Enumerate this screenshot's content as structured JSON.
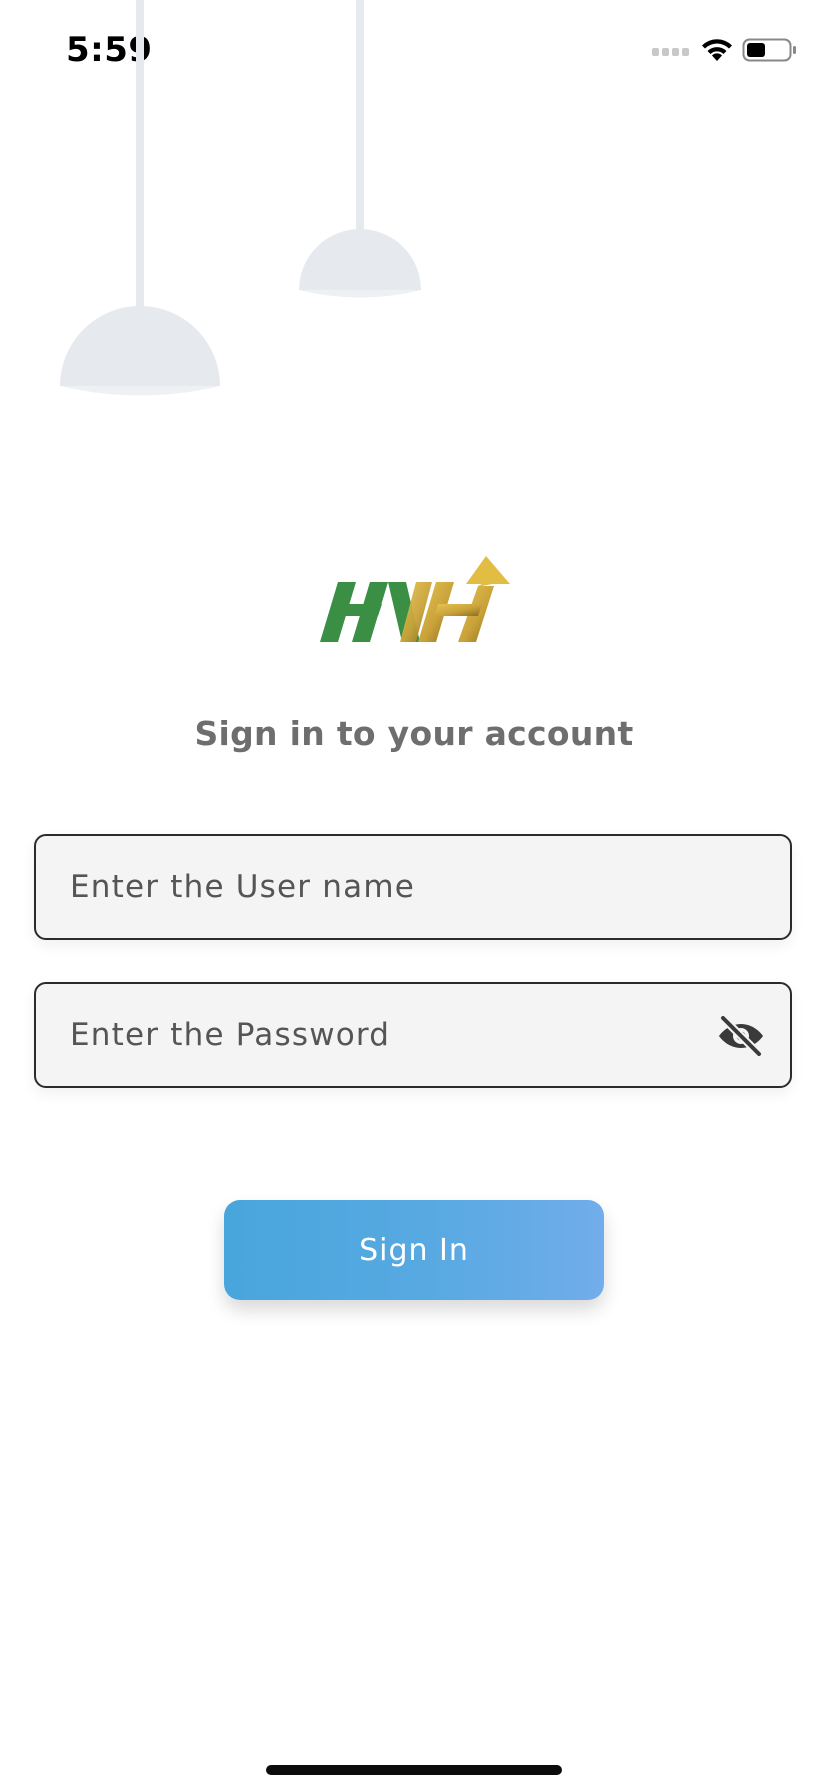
{
  "status_bar": {
    "time": "5:59"
  },
  "login": {
    "heading": "Sign in to your account",
    "username": {
      "value": "",
      "placeholder": "Enter the User name"
    },
    "password": {
      "value": "",
      "placeholder": "Enter the Password",
      "toggle_icon": "eye-off-icon"
    },
    "signin_label": "Sign In"
  },
  "colors": {
    "button_gradient_start": "#48a6dc",
    "button_gradient_end": "#71adea",
    "heading_text": "#6e6e6e",
    "field_background": "#f4f4f4",
    "field_border": "#2b2b2b",
    "lamp_gray": "#e6e9ee",
    "logo_green": "#3a8f45",
    "logo_gold": "#c9a33a"
  }
}
